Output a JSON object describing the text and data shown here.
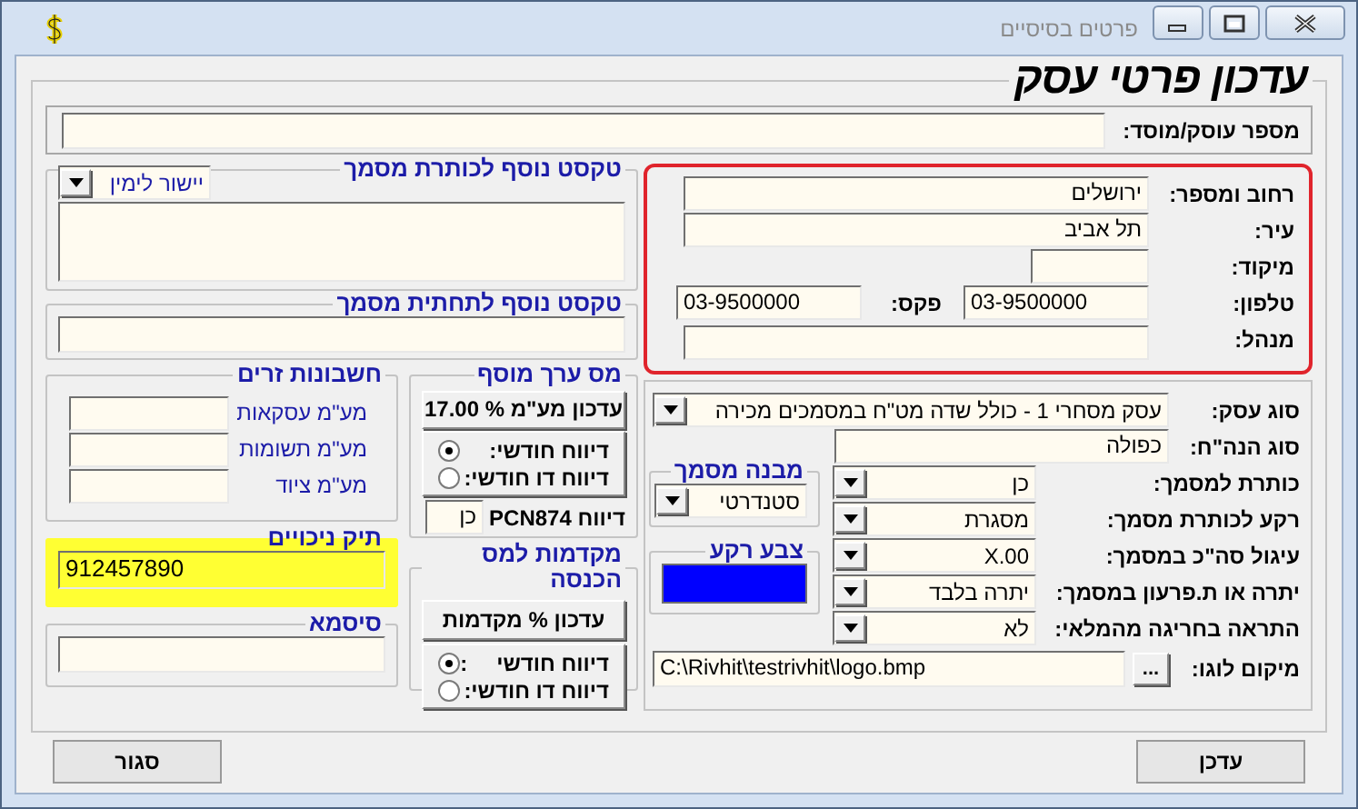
{
  "window": {
    "title": "פרטים בסיסיים"
  },
  "heading": "עדכון פרטי עסק",
  "business_number": {
    "label": "מספר עוסק/מוסד:"
  },
  "header_text": {
    "title": "טקסט נוסף לכותרת מסמך",
    "alignment": "יישור לימין"
  },
  "footer_text": {
    "title": "טקסט נוסף לתחתית מסמך"
  },
  "address": {
    "highlighted": true,
    "street_label": "רחוב ומספר:",
    "street": "ירושלים",
    "city_label": "עיר:",
    "city": "תל אביב",
    "zip_label": "מיקוד:",
    "phone_label": "טלפון:",
    "phone": "03-9500000",
    "fax_label": "פקס:",
    "fax": "03-9500000",
    "manager_label": "מנהל:"
  },
  "foreign_accounts": {
    "title": "חשבונות זרים",
    "rows": [
      {
        "label": "מע\"מ עסקאות"
      },
      {
        "label": "מע\"מ תשומות"
      },
      {
        "label": "מע\"מ ציוד"
      }
    ]
  },
  "vat": {
    "title": "מס ערך מוסף",
    "button": "עדכון מע\"מ % 17.00",
    "options": [
      {
        "label": "דיווח חודשי:",
        "selected": true
      },
      {
        "label": "דיווח דו חודשי:",
        "selected": false
      }
    ],
    "pcn_label": "דיווח PCN874",
    "pcn_value": "כן"
  },
  "deductions": {
    "title": "תיק ניכויים",
    "value": "912457890",
    "highlighted": true
  },
  "advances": {
    "title": "מקדמות למס הכנסה",
    "button": "עדכון % מקדמות",
    "options": [
      {
        "label": "דיווח חודשי",
        "suffix": ":",
        "selected": true
      },
      {
        "label": "דיווח דו חודשי:",
        "selected": false
      }
    ]
  },
  "password": {
    "title": "סיסמא"
  },
  "settings": {
    "rows": [
      {
        "kind": "combo",
        "label": "סוג עסק:",
        "value": "עסק מסחרי 1 - כולל שדה מט\"ח במסמכים מכירה"
      },
      {
        "kind": "text",
        "label": "סוג הנה\"ח:",
        "value": "כפולה"
      },
      {
        "kind": "combo",
        "label": "כותרת למסמך:",
        "value": "כן"
      },
      {
        "kind": "combo",
        "label": "רקע לכותרת מסמך:",
        "value": "מסגרת"
      },
      {
        "kind": "combo",
        "label": "עיגול סה\"כ במסמך:",
        "value": "X.00"
      },
      {
        "kind": "combo",
        "label": "יתרה או ת.פרעון במסמך:",
        "value": "יתרה בלבד"
      },
      {
        "kind": "combo",
        "label": "התראה בחריגה מהמלאי:",
        "value": "לא"
      }
    ],
    "logo_label": "מיקום לוגו:",
    "logo_path": "C:\\Rivhit\\testrivhit\\logo.bmp",
    "browse": "..."
  },
  "doc_structure": {
    "title": "מבנה מסמך",
    "value": "סטנדרטי"
  },
  "background_color": {
    "title": "צבע רקע",
    "color": "#0000ff"
  },
  "update_button": "עדכן",
  "close_button": "סגור"
}
